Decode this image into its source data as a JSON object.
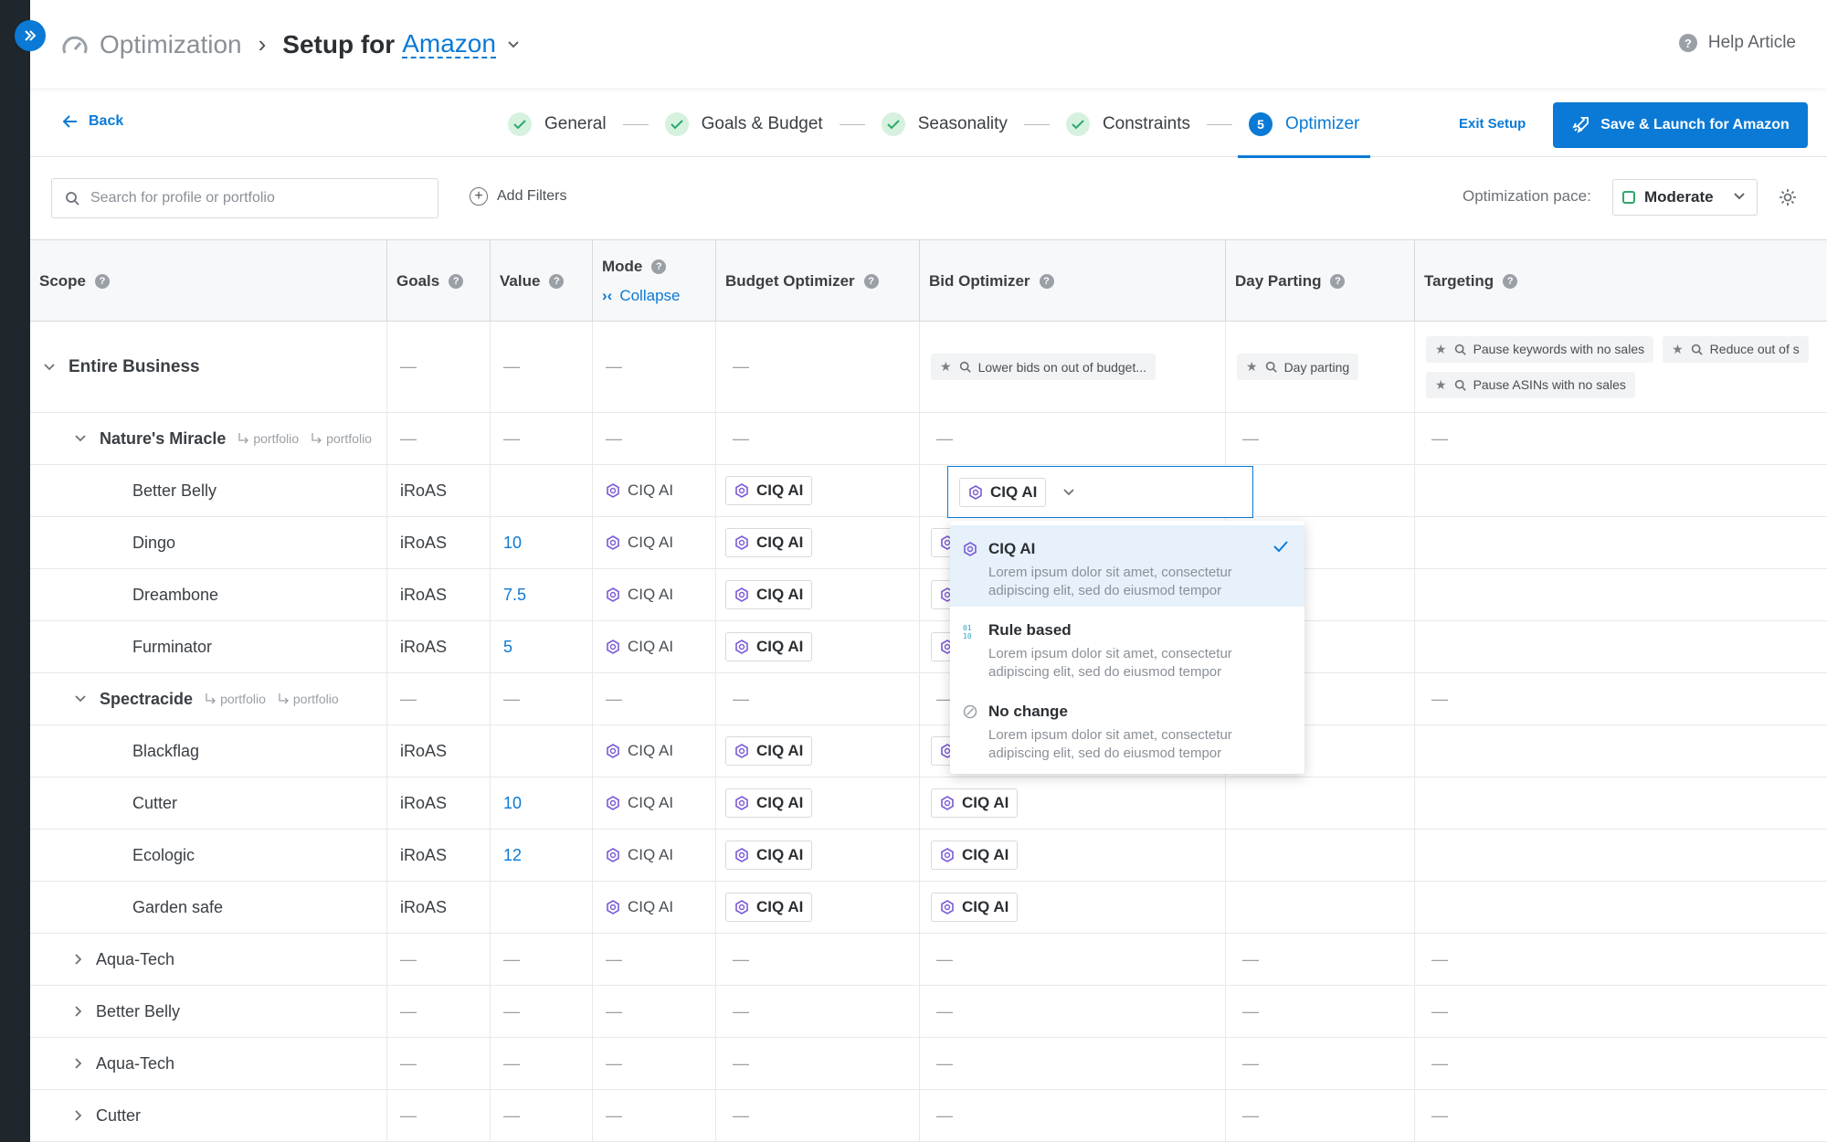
{
  "breadcrumb": {
    "root": "Optimization",
    "title": "Setup for",
    "link": "Amazon"
  },
  "help": {
    "label": "Help Article"
  },
  "nav": {
    "back": "Back",
    "exit": "Exit Setup",
    "launch": "Save & Launch for Amazon"
  },
  "steps": [
    {
      "label": "General",
      "state": "done"
    },
    {
      "label": "Goals & Budget",
      "state": "done"
    },
    {
      "label": "Seasonality",
      "state": "done"
    },
    {
      "label": "Constraints",
      "state": "done"
    },
    {
      "label": "Optimizer",
      "state": "active",
      "number": "5"
    }
  ],
  "filters": {
    "search_placeholder": "Search for profile or portfolio",
    "add_filters": "Add Filters",
    "pace_label": "Optimization pace:",
    "pace_value": "Moderate"
  },
  "columns": {
    "scope": "Scope",
    "goals": "Goals",
    "value": "Value",
    "mode": "Mode",
    "collapse": "Collapse",
    "budget": "Budget Optimizer",
    "bid": "Bid Optimizer",
    "dayparting": "Day Parting",
    "targeting": "Targeting"
  },
  "dash": "—",
  "mode_label": "CIQ AI",
  "portfolio_label": "portfolio",
  "entire_business": {
    "name": "Entire Business",
    "bid_tag": "Lower bids on out of budget...",
    "day_tag": "Day parting",
    "targeting_tags": [
      "Pause keywords with no sales",
      "Reduce out of s",
      "Pause ASINs with no sales"
    ]
  },
  "rows": [
    {
      "name": "Nature's Miracle",
      "level": 1,
      "group": true
    },
    {
      "name": "Better Belly",
      "level": 2,
      "goal": "iRoAS",
      "value": ""
    },
    {
      "name": "Dingo",
      "level": 2,
      "goal": "iRoAS",
      "value": "10"
    },
    {
      "name": "Dreambone",
      "level": 2,
      "goal": "iRoAS",
      "value": "7.5"
    },
    {
      "name": "Furminator",
      "level": 2,
      "goal": "iRoAS",
      "value": "5"
    },
    {
      "name": "Spectracide",
      "level": 1,
      "group": true
    },
    {
      "name": "Blackflag",
      "level": 2,
      "goal": "iRoAS",
      "value": ""
    },
    {
      "name": "Cutter",
      "level": 2,
      "goal": "iRoAS",
      "value": "10"
    },
    {
      "name": "Ecologic",
      "level": 2,
      "goal": "iRoAS",
      "value": "12"
    },
    {
      "name": "Garden safe",
      "level": 2,
      "goal": "iRoAS",
      "value": ""
    },
    {
      "name": "Aqua-Tech",
      "level": 1,
      "collapsed": true
    },
    {
      "name": "Better Belly",
      "level": 1,
      "collapsed": true
    },
    {
      "name": "Aqua-Tech",
      "level": 1,
      "collapsed": true
    },
    {
      "name": "Cutter",
      "level": 1,
      "collapsed": true
    }
  ],
  "dropdown": {
    "options": [
      {
        "title": "CIQ AI",
        "desc_1": "Lorem ipsum dolor sit amet, consectetur",
        "desc_2": "adipiscing elit, sed do eiusmod tempor",
        "selected": true,
        "icon": "hexagon-icon"
      },
      {
        "title": "Rule based",
        "desc_1": "Lorem ipsum dolor sit amet, consectetur",
        "desc_2": "adipiscing elit, sed do eiusmod tempor",
        "icon": "binary-icon"
      },
      {
        "title": "No change",
        "desc_1": "Lorem ipsum dolor sit amet, consectetur",
        "desc_2": "adipiscing elit, sed do eiusmod tempor",
        "icon": "no-change-icon"
      }
    ]
  },
  "colors": {
    "accent": "#0a7ad6",
    "success": "#2ea86a",
    "sidebar": "#1f262c",
    "ciq": "#7b5bd6"
  }
}
